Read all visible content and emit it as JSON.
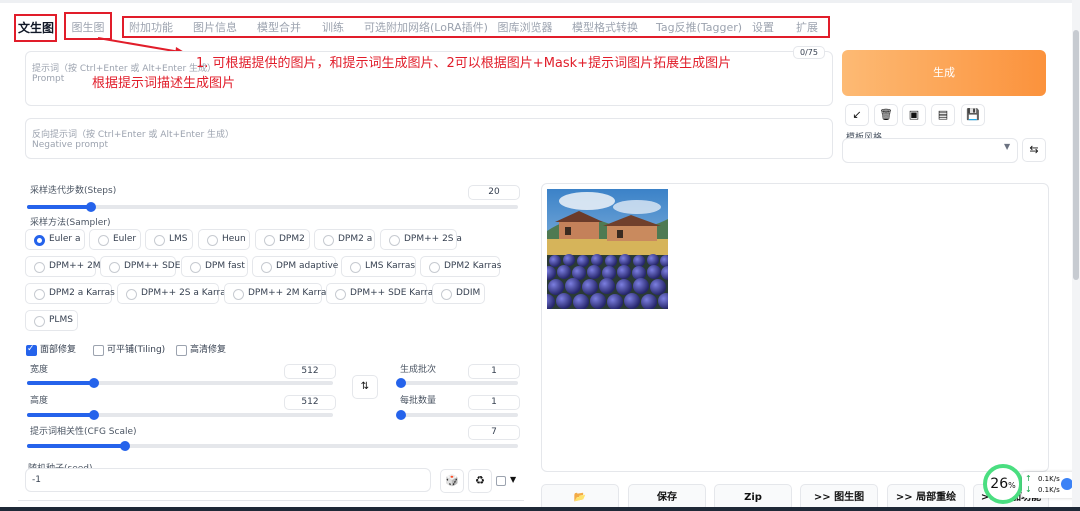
{
  "tabs": [
    {
      "label": "文生图"
    },
    {
      "label": "图生图"
    },
    {
      "label": "附加功能"
    },
    {
      "label": "图片信息"
    },
    {
      "label": "模型合并"
    },
    {
      "label": "训练"
    },
    {
      "label": "可选附加网络(LoRA插件)"
    },
    {
      "label": "图库浏览器"
    },
    {
      "label": "模型格式转换"
    },
    {
      "label": "Tag反推(Tagger)"
    },
    {
      "label": "设置"
    },
    {
      "label": "扩展"
    }
  ],
  "annotations": {
    "line1": "1. 可根据提供的图片，和提示词生成图片、2可以根据图片+Mask+提示词图片拓展生成图片",
    "line2": "根据提示词描述生成图片"
  },
  "prompt": {
    "placeholder_cn": "提示词（按 Ctrl+Enter 或 Alt+Enter 生成）",
    "placeholder_en": "Prompt",
    "counter": "0/75"
  },
  "negative": {
    "placeholder_cn": "反向提示词（按 Ctrl+Enter 或 Alt+Enter 生成）",
    "placeholder_en": "Negative prompt"
  },
  "generate_label": "生成",
  "style_label": "模板风格",
  "steps": {
    "label": "采样迭代步数(Steps)",
    "value": "20",
    "fraction": 0.13
  },
  "sampler": {
    "label": "采样方法(Sampler)",
    "selected": "Euler a",
    "options": [
      "Euler a",
      "Euler",
      "LMS",
      "Heun",
      "DPM2",
      "DPM2 a",
      "DPM++ 2S a",
      "DPM++ 2M",
      "DPM++ SDE",
      "DPM fast",
      "DPM adaptive",
      "LMS Karras",
      "DPM2 Karras",
      "DPM2 a Karras",
      "DPM++ 2S a Karras",
      "DPM++ 2M Karras",
      "DPM++ SDE Karras",
      "DDIM",
      "PLMS"
    ]
  },
  "checkboxes": {
    "face_restore": "面部修复",
    "tiling": "可平铺(Tiling)",
    "hires": "高清修复"
  },
  "width": {
    "label": "宽度",
    "value": "512",
    "fraction": 0.22
  },
  "height": {
    "label": "高度",
    "value": "512",
    "fraction": 0.22
  },
  "batch_count": {
    "label": "生成批次",
    "value": "1",
    "fraction": 0.0
  },
  "batch_size": {
    "label": "每批数量",
    "value": "1",
    "fraction": 0.0
  },
  "cfg": {
    "label": "提示词相关性(CFG Scale)",
    "value": "7",
    "fraction": 0.2
  },
  "seed": {
    "label": "随机种子(seed)",
    "value": "-1"
  },
  "output_buttons": {
    "folder": "📂",
    "save": "保存",
    "zip": "Zip",
    "to_img2img": ">> 图生图",
    "to_inpaint": ">> 局部重绘",
    "to_extras": ">> 附加功能"
  },
  "progress": {
    "percent": "26",
    "unit": "%",
    "up": "0.1K/s",
    "down": "0.1K/s"
  }
}
